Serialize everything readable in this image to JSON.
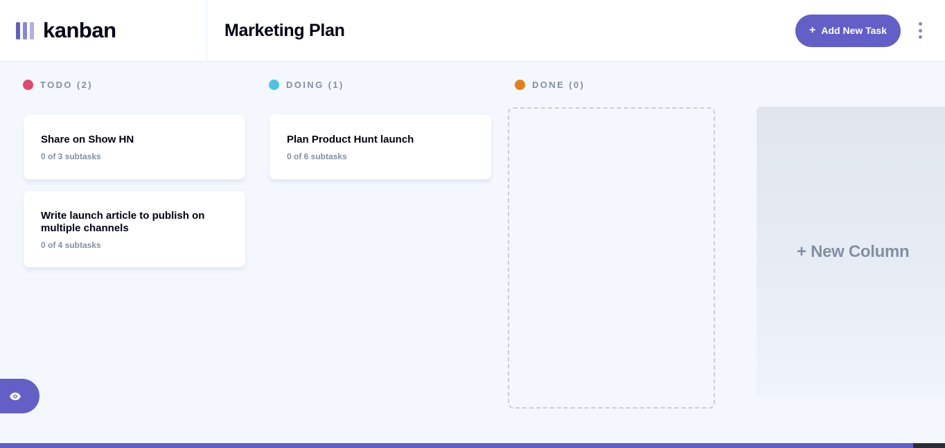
{
  "app": {
    "name": "kanban"
  },
  "header": {
    "board_title": "Marketing Plan",
    "add_task_label": "Add New Task",
    "add_task_icon": "plus-icon",
    "menu_icon": "vertical-ellipsis-icon"
  },
  "columns": [
    {
      "name": "TODO (2)",
      "dot_color": "#E0496C",
      "tasks": [
        {
          "title": "Share on Show HN",
          "subtasks": "0 of 3 subtasks"
        },
        {
          "title": "Write launch article to publish on multiple channels",
          "subtasks": "0 of 4 subtasks"
        }
      ]
    },
    {
      "name": "DOING (1)",
      "dot_color": "#49C4E5",
      "tasks": [
        {
          "title": "Plan Product Hunt launch",
          "subtasks": "0 of 6 subtasks"
        }
      ]
    },
    {
      "name": "DONE (0)",
      "dot_color": "#E67E17",
      "tasks": []
    }
  ],
  "new_column_label": "+ New Column",
  "sidebar_toggle_icon": "eye-icon",
  "colors": {
    "accent": "#635FC7",
    "background": "#F4F7FD",
    "text_muted": "#828FA3"
  }
}
